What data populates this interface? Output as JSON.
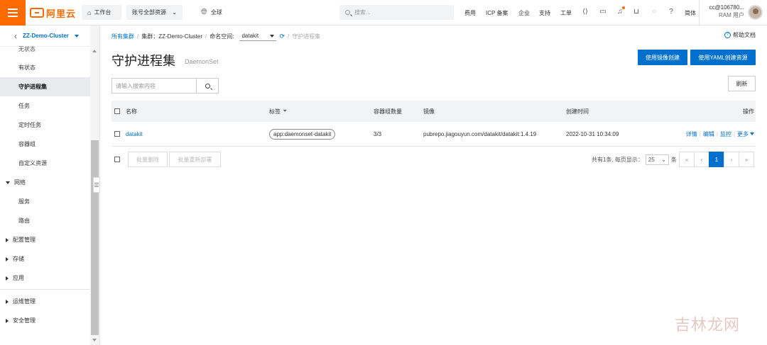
{
  "topbar": {
    "logo_text": "阿里云",
    "workbench": "工作台",
    "account_scope": "账号全部资源",
    "region": "全球",
    "search_placeholder": "搜索...",
    "links": [
      "费用",
      "ICP 备案",
      "企业",
      "支持",
      "工单"
    ],
    "language": "简体",
    "user_name": "cc@106780...",
    "user_role": "RAM 用户",
    "accent_color": "#ff6a00"
  },
  "sidebar": {
    "cluster": "ZZ-Demo-Cluster",
    "items_top": [
      "无状态",
      "有状态",
      "守护进程集",
      "任务",
      "定时任务",
      "容器组",
      "自定义资源"
    ],
    "active_item": "守护进程集",
    "network_group": "网络",
    "network_items": [
      "服务",
      "路由"
    ],
    "groups_collapsed": [
      "配置管理",
      "存储",
      "应用"
    ],
    "groups_bottom": [
      "运维管理",
      "安全管理"
    ]
  },
  "breadcrumb": {
    "root": "所有集群",
    "cluster_label": "集群：ZZ-Demo-Cluster",
    "namespace_label": "命名空间:",
    "namespace_value": "datakit",
    "current": "守护进程集"
  },
  "help": "帮助文档",
  "page": {
    "title": "守护进程集",
    "subtitle": "DaemonSet",
    "btn_image_create": "使用镜像创建",
    "btn_yaml_create": "使用YAML创建资源",
    "search_placeholder": "请输入搜索内容",
    "refresh": "刷新"
  },
  "table": {
    "headers": {
      "name": "名称",
      "labels": "标签",
      "replicas": "容器组数量",
      "image": "镜像",
      "created": "创建时间",
      "actions": "操作"
    },
    "rows": [
      {
        "name": "datakit",
        "label": "app:daemonset-datakit",
        "replicas": "3/3",
        "image": "pubrepo.jiagouyun.com/datakit/datakit:1.4.19",
        "created": "2022-10-31 10:34:09",
        "actions": [
          "详情",
          "编辑",
          "监控",
          "更多"
        ]
      }
    ],
    "batch_delete": "批量删除",
    "batch_redeploy": "批量重新部署",
    "total_text": "共有1条, 每页显示：",
    "page_size": "25",
    "page_size_unit": "条",
    "current_page": "1"
  },
  "watermark": "吉林龙网"
}
